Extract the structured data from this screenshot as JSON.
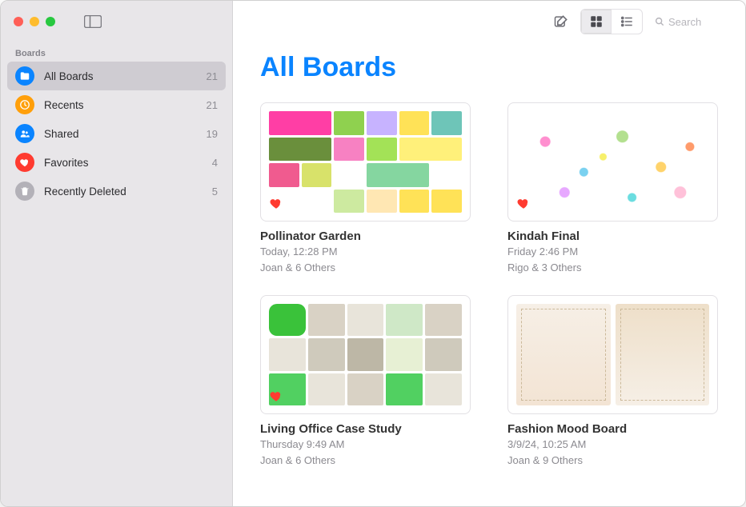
{
  "sidebar": {
    "header": "Boards",
    "items": [
      {
        "label": "All Boards",
        "count": "21",
        "icon": "folder",
        "selected": true
      },
      {
        "label": "Recents",
        "count": "21",
        "icon": "clock",
        "selected": false
      },
      {
        "label": "Shared",
        "count": "19",
        "icon": "people",
        "selected": false
      },
      {
        "label": "Favorites",
        "count": "4",
        "icon": "heart",
        "selected": false
      },
      {
        "label": "Recently Deleted",
        "count": "5",
        "icon": "trash",
        "selected": false
      }
    ]
  },
  "toolbar": {
    "search_placeholder": "Search"
  },
  "page": {
    "title": "All Boards"
  },
  "boards": [
    {
      "title": "Pollinator Garden",
      "timestamp": "Today, 12:28 PM",
      "sharing": "Joan & 6 Others",
      "favorite": true
    },
    {
      "title": "Kindah Final",
      "timestamp": "Friday 2:46 PM",
      "sharing": "Rigo & 3 Others",
      "favorite": true
    },
    {
      "title": "Living Office Case Study",
      "timestamp": "Thursday 9:49 AM",
      "sharing": "Joan & 6 Others",
      "favorite": true
    },
    {
      "title": "Fashion Mood Board",
      "timestamp": "3/9/24, 10:25 AM",
      "sharing": "Joan & 9 Others",
      "favorite": false
    }
  ]
}
